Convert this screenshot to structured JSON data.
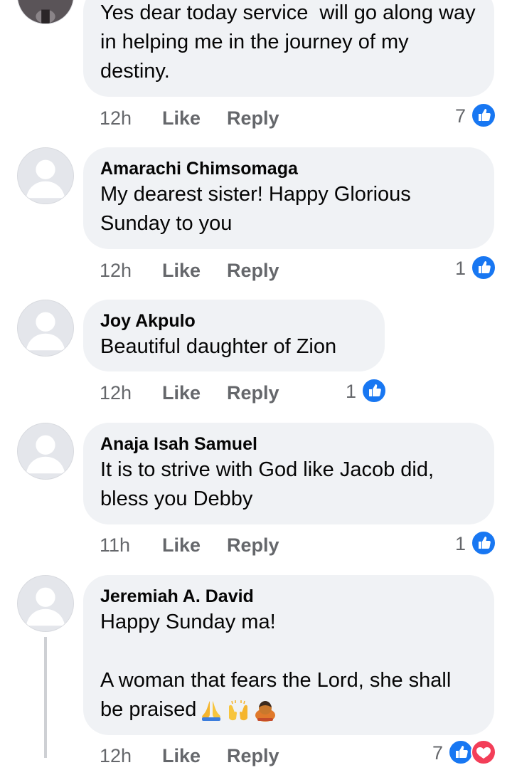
{
  "comments": [
    {
      "author": "",
      "text": "Yes dear today service  will go along way in helping me in the journey of my destiny.",
      "time": "12h",
      "like": "Like",
      "reply": "Reply",
      "reactions": "7"
    },
    {
      "author": "Amarachi Chimsomaga",
      "text": "My dearest sister! Happy Glorious Sunday to you",
      "time": "12h",
      "like": "Like",
      "reply": "Reply",
      "reactions": "1"
    },
    {
      "author": "Joy Akpulo",
      "text": "Beautiful daughter of Zion",
      "time": "12h",
      "like": "Like",
      "reply": "Reply",
      "reactions": "1"
    },
    {
      "author": "Anaja Isah Samuel",
      "text": "It is to strive with God like Jacob did, bless you Debby",
      "time": "11h",
      "like": "Like",
      "reply": "Reply",
      "reactions": "1"
    },
    {
      "author": "Jeremiah A. David",
      "text_line1": "Happy Sunday ma!",
      "text_line2": "A woman that fears the Lord, she shall be praised",
      "emojis": [
        "folded-hands",
        "raising-hands",
        "person-bowing"
      ],
      "time": "12h",
      "like": "Like",
      "reply": "Reply",
      "reactions": "7"
    }
  ],
  "colors": {
    "bubble": "#f0f2f5",
    "meta": "#65676b",
    "like_blue": "#1877f2",
    "love_red": "#f33e58"
  }
}
